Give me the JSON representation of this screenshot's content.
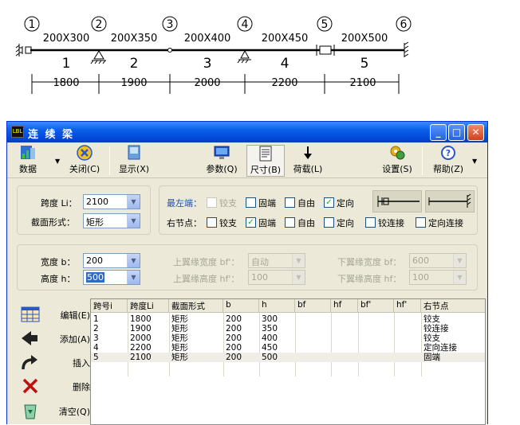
{
  "diagram": {
    "nodes": [
      "1",
      "2",
      "3",
      "4",
      "5",
      "6"
    ],
    "sections": [
      "200X300",
      "200X350",
      "200X400",
      "200X450",
      "200X500"
    ],
    "spans": [
      "1",
      "2",
      "3",
      "4",
      "5"
    ],
    "lengths": [
      "1800",
      "1900",
      "2000",
      "2200",
      "2100"
    ]
  },
  "window": {
    "icon_text": "LBL",
    "title": "连 续 梁"
  },
  "toolbar": {
    "data": "数据",
    "close": "关闭(C)",
    "display": "显示(X)",
    "params": "参数(Q)",
    "size": "尺寸(B)",
    "load": "荷载(L)",
    "settings": "设置(S)",
    "help": "帮助(Z)"
  },
  "span_group": {
    "span_label": "跨度 Li：",
    "span_value": "2100",
    "shape_label": "截面形式：",
    "shape_value": "矩形"
  },
  "ends": {
    "left_label": "最左端：",
    "right_label": "右节点：",
    "opts": [
      "铰支",
      "固端",
      "自由",
      "定向"
    ],
    "left_checked": [
      false,
      false,
      false,
      true
    ],
    "right_checked": [
      false,
      true,
      false,
      false
    ],
    "hinge_conn": "铰连接",
    "dir_conn": "定向连接"
  },
  "dims": {
    "width_label": "宽度 b：",
    "width_value": "200",
    "height_label": "高度 h：",
    "height_value": "500",
    "top_flange_width_label": "上翼缘宽度 bf'：",
    "top_flange_width_value": "自动",
    "top_flange_height_label": "上翼缘高度 hf'：",
    "top_flange_height_value": "100",
    "bot_flange_width_label": "下翼缘宽度 bf：",
    "bot_flange_width_value": "600",
    "bot_flange_height_label": "下翼缘高度 hf：",
    "bot_flange_height_value": "100"
  },
  "side": {
    "edit": "编辑(E)",
    "add": "添加(A)",
    "insert": "插入",
    "delete": "删除",
    "clear": "清空(Q)"
  },
  "table": {
    "headers": [
      "跨号i",
      "跨度Li",
      "截面形式",
      "b",
      "h",
      "bf",
      "hf",
      "bf'",
      "hf'",
      "右节点"
    ],
    "rows": [
      [
        "1",
        "1800",
        "矩形",
        "200",
        "300",
        "",
        "",
        "",
        "",
        "铰支"
      ],
      [
        "2",
        "1900",
        "矩形",
        "200",
        "350",
        "",
        "",
        "",
        "",
        "铰连接"
      ],
      [
        "3",
        "2000",
        "矩形",
        "200",
        "400",
        "",
        "",
        "",
        "",
        "铰支"
      ],
      [
        "4",
        "2200",
        "矩形",
        "200",
        "450",
        "",
        "",
        "",
        "",
        "定向连接"
      ],
      [
        "5",
        "2100",
        "矩形",
        "200",
        "500",
        "",
        "",
        "",
        "",
        "固端"
      ]
    ]
  }
}
